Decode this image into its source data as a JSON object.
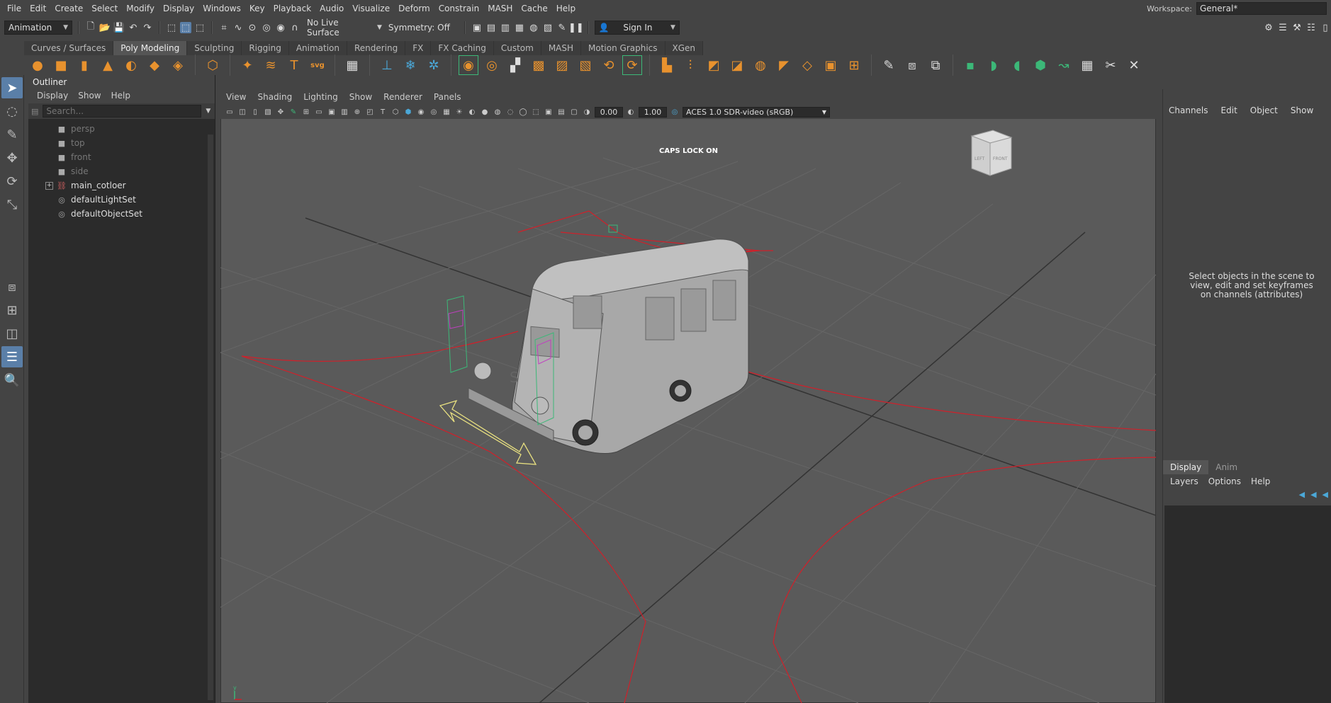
{
  "menubar": [
    "File",
    "Edit",
    "Create",
    "Select",
    "Modify",
    "Display",
    "Windows",
    "Key",
    "Playback",
    "Audio",
    "Visualize",
    "Deform",
    "Constrain",
    "MASH",
    "Cache",
    "Help"
  ],
  "workspace": {
    "label": "Workspace:",
    "value": "General*"
  },
  "status": {
    "mode": "Animation",
    "live_surface": "No Live Surface",
    "symmetry": "Symmetry: Off",
    "sign_in": "Sign In"
  },
  "shelf_tabs": [
    "Curves / Surfaces",
    "Poly Modeling",
    "Sculpting",
    "Rigging",
    "Animation",
    "Rendering",
    "FX",
    "FX Caching",
    "Custom",
    "MASH",
    "Motion Graphics",
    "XGen"
  ],
  "shelf_active": "Poly Modeling",
  "outliner": {
    "title": "Outliner",
    "menu": [
      "Display",
      "Show",
      "Help"
    ],
    "search_placeholder": "Search...",
    "items": [
      {
        "label": "persp",
        "kind": "camera"
      },
      {
        "label": "top",
        "kind": "camera"
      },
      {
        "label": "front",
        "kind": "camera"
      },
      {
        "label": "side",
        "kind": "camera"
      },
      {
        "label": "main_cotloer",
        "kind": "group"
      },
      {
        "label": "defaultLightSet",
        "kind": "set"
      },
      {
        "label": "defaultObjectSet",
        "kind": "set"
      }
    ]
  },
  "viewport": {
    "menu": [
      "View",
      "Shading",
      "Lighting",
      "Show",
      "Renderer",
      "Panels"
    ],
    "exposure": "0.00",
    "gamma": "1.00",
    "colorspace": "ACES 1.0 SDR-video (sRGB)",
    "caps": "CAPS LOCK ON",
    "viewcube_left": "LEFT",
    "viewcube_front": "FRONT"
  },
  "channelbox": {
    "menu": [
      "Channels",
      "Edit",
      "Object",
      "Show"
    ],
    "message": "Select objects in the scene to view, edit and set keyframes on channels (attributes)",
    "layer_tabs": [
      "Display",
      "Anim"
    ],
    "layer_menu": [
      "Layers",
      "Options",
      "Help"
    ]
  },
  "colors": {
    "accent": "#5a7fa8",
    "shelf_orange": "#e8922e",
    "curve_red": "#d0202a"
  }
}
